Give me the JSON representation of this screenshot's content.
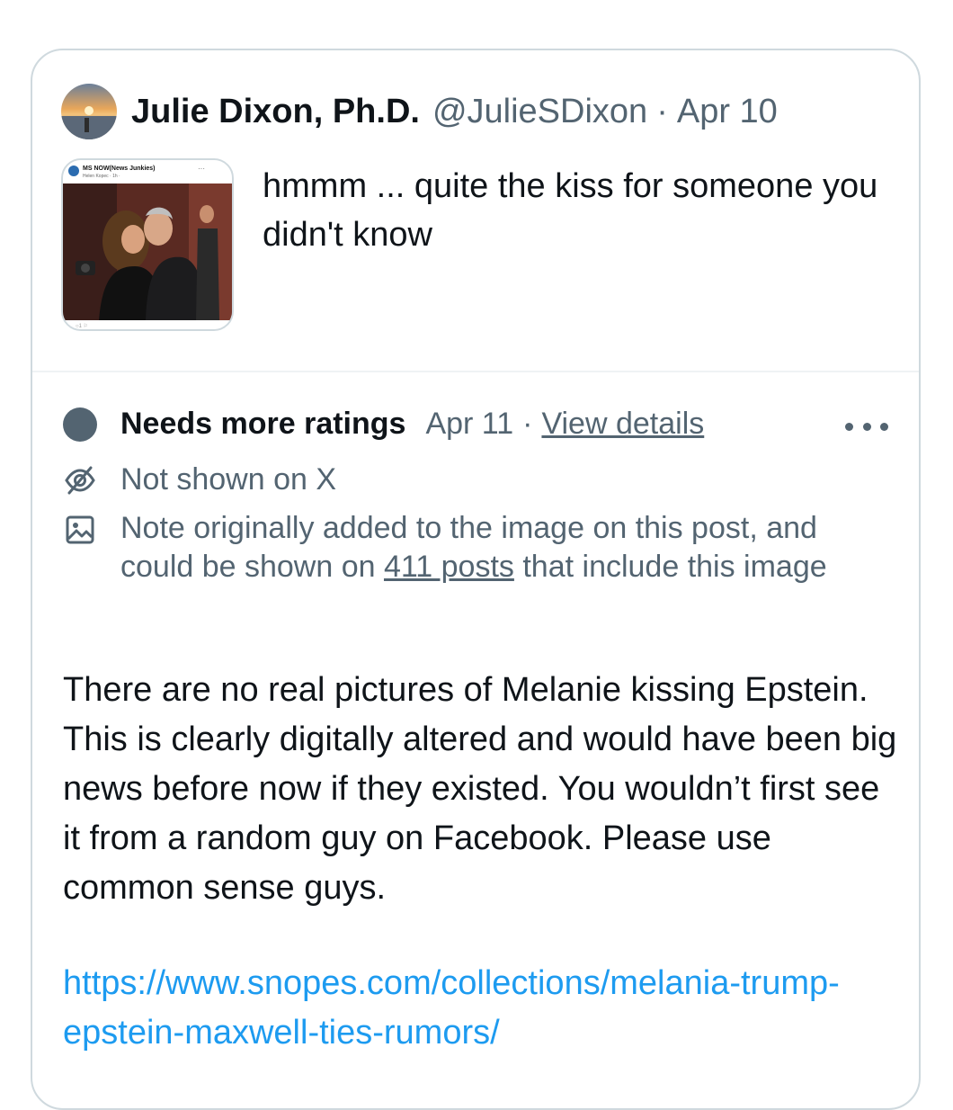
{
  "post": {
    "author_name": "Julie Dixon, Ph.D.",
    "author_handle": "@JulieSDixon",
    "separator": "·",
    "date": "Apr 10",
    "text": "hmmm ... quite the kiss for someone you didn't know",
    "thumbnail": {
      "page_name": "MS NOW(News Junkies)",
      "poster": "Helen Kopec · 1h · "
    }
  },
  "note": {
    "status": "Needs more ratings",
    "date": "Apr 11",
    "separator": "·",
    "view_details": "View details",
    "not_shown": "Not shown on X",
    "image_note_prefix": "Note originally added to the image on this post, and could be shown on ",
    "posts_count_link": "411 posts",
    "image_note_suffix": " that include this image",
    "body": "There are no real pictures of Melanie kissing Epstein. This is clearly digitally altered and would have been big news before now if they existed. You wouldn’t first see it from a random guy on Facebook. Please use common sense guys.",
    "link": "https://www.snopes.com/collections/melania-trump-epstein-maxwell-ties-rumors/"
  },
  "colors": {
    "text_primary": "#0f1419",
    "text_secondary": "#536471",
    "link": "#1d9bf0",
    "border": "#cfd9de"
  },
  "icons": {
    "status": "status-dot-icon",
    "visibility": "eye-off-icon",
    "image": "image-icon",
    "more": "more-options-icon"
  }
}
